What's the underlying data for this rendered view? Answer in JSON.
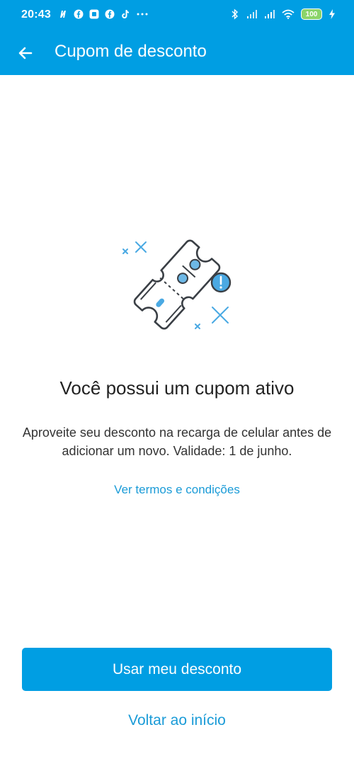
{
  "status_bar": {
    "time": "20:43",
    "notification_icons": [
      "nubank-icon",
      "facebook-icon",
      "app-icon",
      "facebook-icon",
      "tiktok-icon",
      "more-dots-icon"
    ],
    "right_icons": [
      "bluetooth-icon",
      "signal-icon",
      "signal-icon",
      "wifi-icon",
      "battery-icon",
      "charging-icon"
    ],
    "battery_level": "100"
  },
  "app_bar": {
    "title": "Cupom de desconto",
    "back_icon": "arrow-left-icon",
    "background_color": "#009ee3"
  },
  "content": {
    "illustration_icon": "discount-coupon-icon",
    "heading": "Você possui um cupom ativo",
    "description": "Aproveite seu desconto na recarga de celular antes de adicionar um novo. Validade: 1 de junho.",
    "terms_link": "Ver termos e condições"
  },
  "actions": {
    "primary_label": "Usar meu desconto",
    "secondary_label": "Voltar ao início"
  },
  "colors": {
    "accent": "#009ee3",
    "link": "#1a9bd7"
  }
}
